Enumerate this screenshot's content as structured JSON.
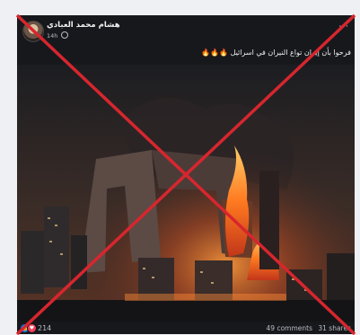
{
  "post": {
    "author": "هشام محمد العبادي",
    "time": "14h",
    "caption": "فرحوا بأن إيران تواع النيران في اسرائيل 🔥🔥🔥",
    "more": "···"
  },
  "footer": {
    "reaction_count": "214",
    "comments": "49 comments",
    "shares": "31 shares"
  },
  "icons": [
    "globe-icon",
    "like-icon",
    "love-icon",
    "more-icon"
  ],
  "colors": {
    "card_bg": "#17181c",
    "cross": "#d7262e",
    "like": "#1877f2",
    "love": "#f33e58"
  }
}
